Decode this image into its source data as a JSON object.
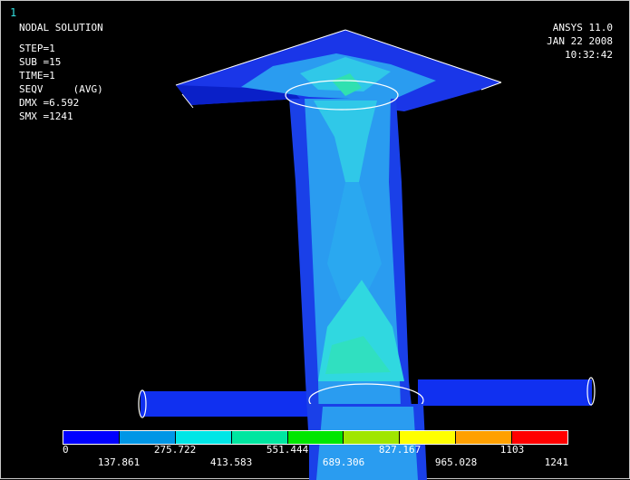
{
  "window_number": "1",
  "info": {
    "title": "NODAL SOLUTION",
    "step": "STEP=1",
    "sub": "SUB =15",
    "time": "TIME=1",
    "seqv": "SEQV     (AVG)",
    "dmx": "DMX =6.592",
    "smx": "SMX =1241"
  },
  "stamp": {
    "product": "ANSYS 11.0",
    "date": "JAN 22 2008",
    "clock": "10:32:42"
  },
  "legend": {
    "colors": [
      "#0000ff",
      "#0096e6",
      "#00e6e6",
      "#00e6a0",
      "#00e600",
      "#a0e600",
      "#ffff00",
      "#ffa000",
      "#ff0000"
    ],
    "labels_top": [
      "0",
      "275.722",
      "551.444",
      "827.167",
      "1103"
    ],
    "labels_bottom": [
      "137.861",
      "413.583",
      "689.306",
      "965.028",
      "1241"
    ]
  }
}
